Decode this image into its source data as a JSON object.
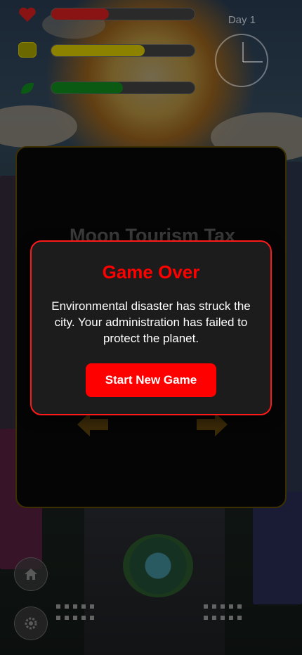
{
  "hud": {
    "day_label": "Day 1",
    "meters": [
      {
        "name": "health",
        "icon": "heart-icon",
        "color": "#c41616",
        "level": 0.4
      },
      {
        "name": "economy",
        "icon": "money-icon",
        "color": "#c9b800",
        "level": 0.65
      },
      {
        "name": "environment",
        "icon": "leaf-icon",
        "color": "#0f8a1f",
        "level": 0.5
      }
    ]
  },
  "policy_card": {
    "title": "Moon Tourism Tax"
  },
  "game_over": {
    "title": "Game Over",
    "message": "Environmental disaster has struck the city. Your administration has failed to protect the planet.",
    "button_label": "Start New Game",
    "accent": "#ff0000"
  },
  "bottom_buttons": [
    {
      "icon": "home-icon"
    },
    {
      "icon": "gear-icon"
    }
  ]
}
